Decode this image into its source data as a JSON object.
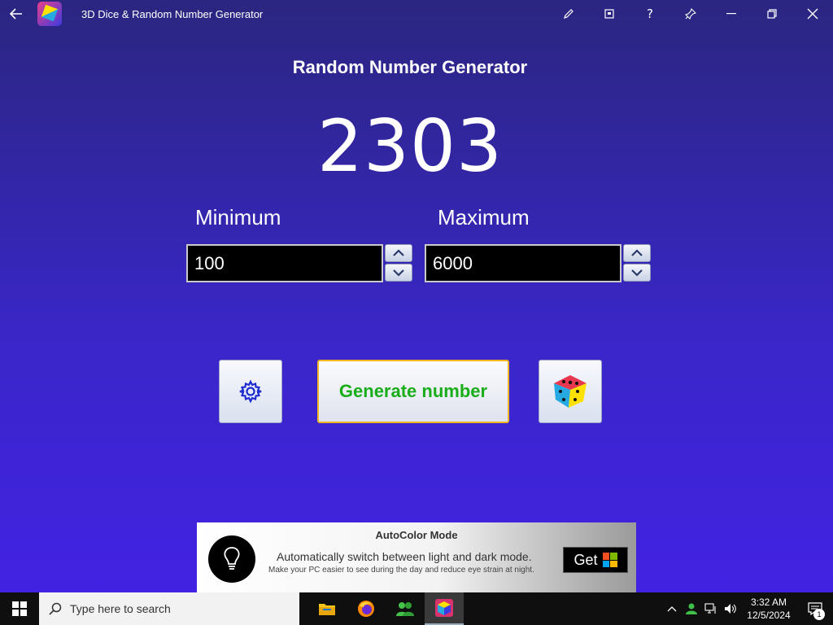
{
  "window": {
    "title": "3D Dice & Random Number Generator",
    "icons": [
      "back-arrow-icon",
      "pen-icon",
      "compact-overlay-icon",
      "help-icon",
      "pin-icon",
      "minimize-icon",
      "restore-icon",
      "close-icon"
    ],
    "help_glyph": "?"
  },
  "app": {
    "heading": "Random Number Generator",
    "result": "2303",
    "minimum_label": "Minimum",
    "maximum_label": "Maximum",
    "minimum_value": "100",
    "maximum_value": "6000",
    "generate_label": "Generate number",
    "accent_color": "#f0b722",
    "generate_text_color": "#1aad1a"
  },
  "ad": {
    "title": "AutoColor Mode",
    "main_text": "Automatically switch between light and dark mode.",
    "sub_text": "Make your PC easier to see during the day and reduce eye strain at night.",
    "get_label": "Get"
  },
  "taskbar": {
    "search_placeholder": "Type here to search",
    "apps": [
      "file-explorer-icon",
      "firefox-icon",
      "people-app-icon",
      "dice-app-icon"
    ],
    "clock_time": "3:32 AM",
    "clock_date": "12/5/2024",
    "notification_count": "1"
  }
}
